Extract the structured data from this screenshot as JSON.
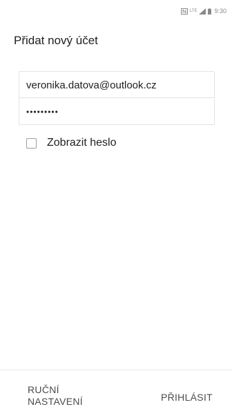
{
  "status_bar": {
    "icons": [
      "nfc-icon",
      "lte-icon",
      "signal-icon",
      "battery-icon"
    ],
    "lte_text": "LTE",
    "time": "9:30"
  },
  "app_bar": {
    "title": "Přidat nový účet"
  },
  "form": {
    "email": {
      "value": "veronika.datova@outlook.cz"
    },
    "password": {
      "value": "•••••••••"
    }
  },
  "show_password": {
    "label": "Zobrazit heslo",
    "checked": false
  },
  "bottom_bar": {
    "manual_setup_line1": "RUČNÍ",
    "manual_setup_line2": "NASTAVENÍ",
    "login_label": "PŘIHLÁSIT"
  },
  "colors": {
    "text": "#212121",
    "muted": "#8a8a8a",
    "divider": "#e3e3e3",
    "background": "#ffffff"
  }
}
